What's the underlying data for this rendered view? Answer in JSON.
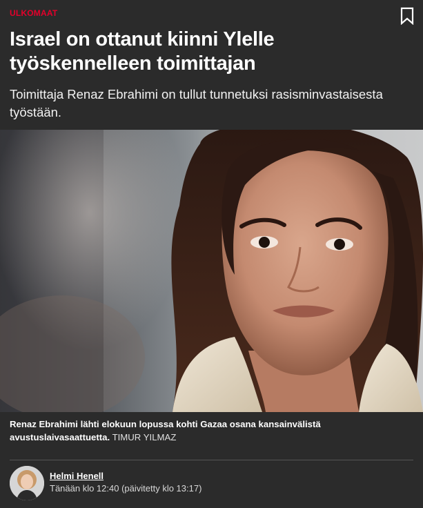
{
  "article": {
    "category": "ULKOMAAT",
    "headline": "Israel on ottanut kiinni Ylelle työskennelleen toimittajan",
    "lead": "Toimittaja Renaz Ebrahimi on tullut tunnetuksi rasisminvastaisesta työstään.",
    "image": {
      "caption": "Renaz Ebrahimi lähti elokuun lopussa kohti Gazaa osana kansainvälistä avustuslaivasaattuetta.",
      "credit": "TIMUR YILMAZ"
    },
    "author": {
      "name": "Helmi Henell",
      "timestamp": "Tänään klo 12:40 (päivitetty klo 13:17)"
    }
  },
  "icons": {
    "bookmark": "bookmark-icon"
  },
  "colors": {
    "background": "#2b2b2b",
    "category": "#e4002b",
    "text": "#ffffff"
  }
}
